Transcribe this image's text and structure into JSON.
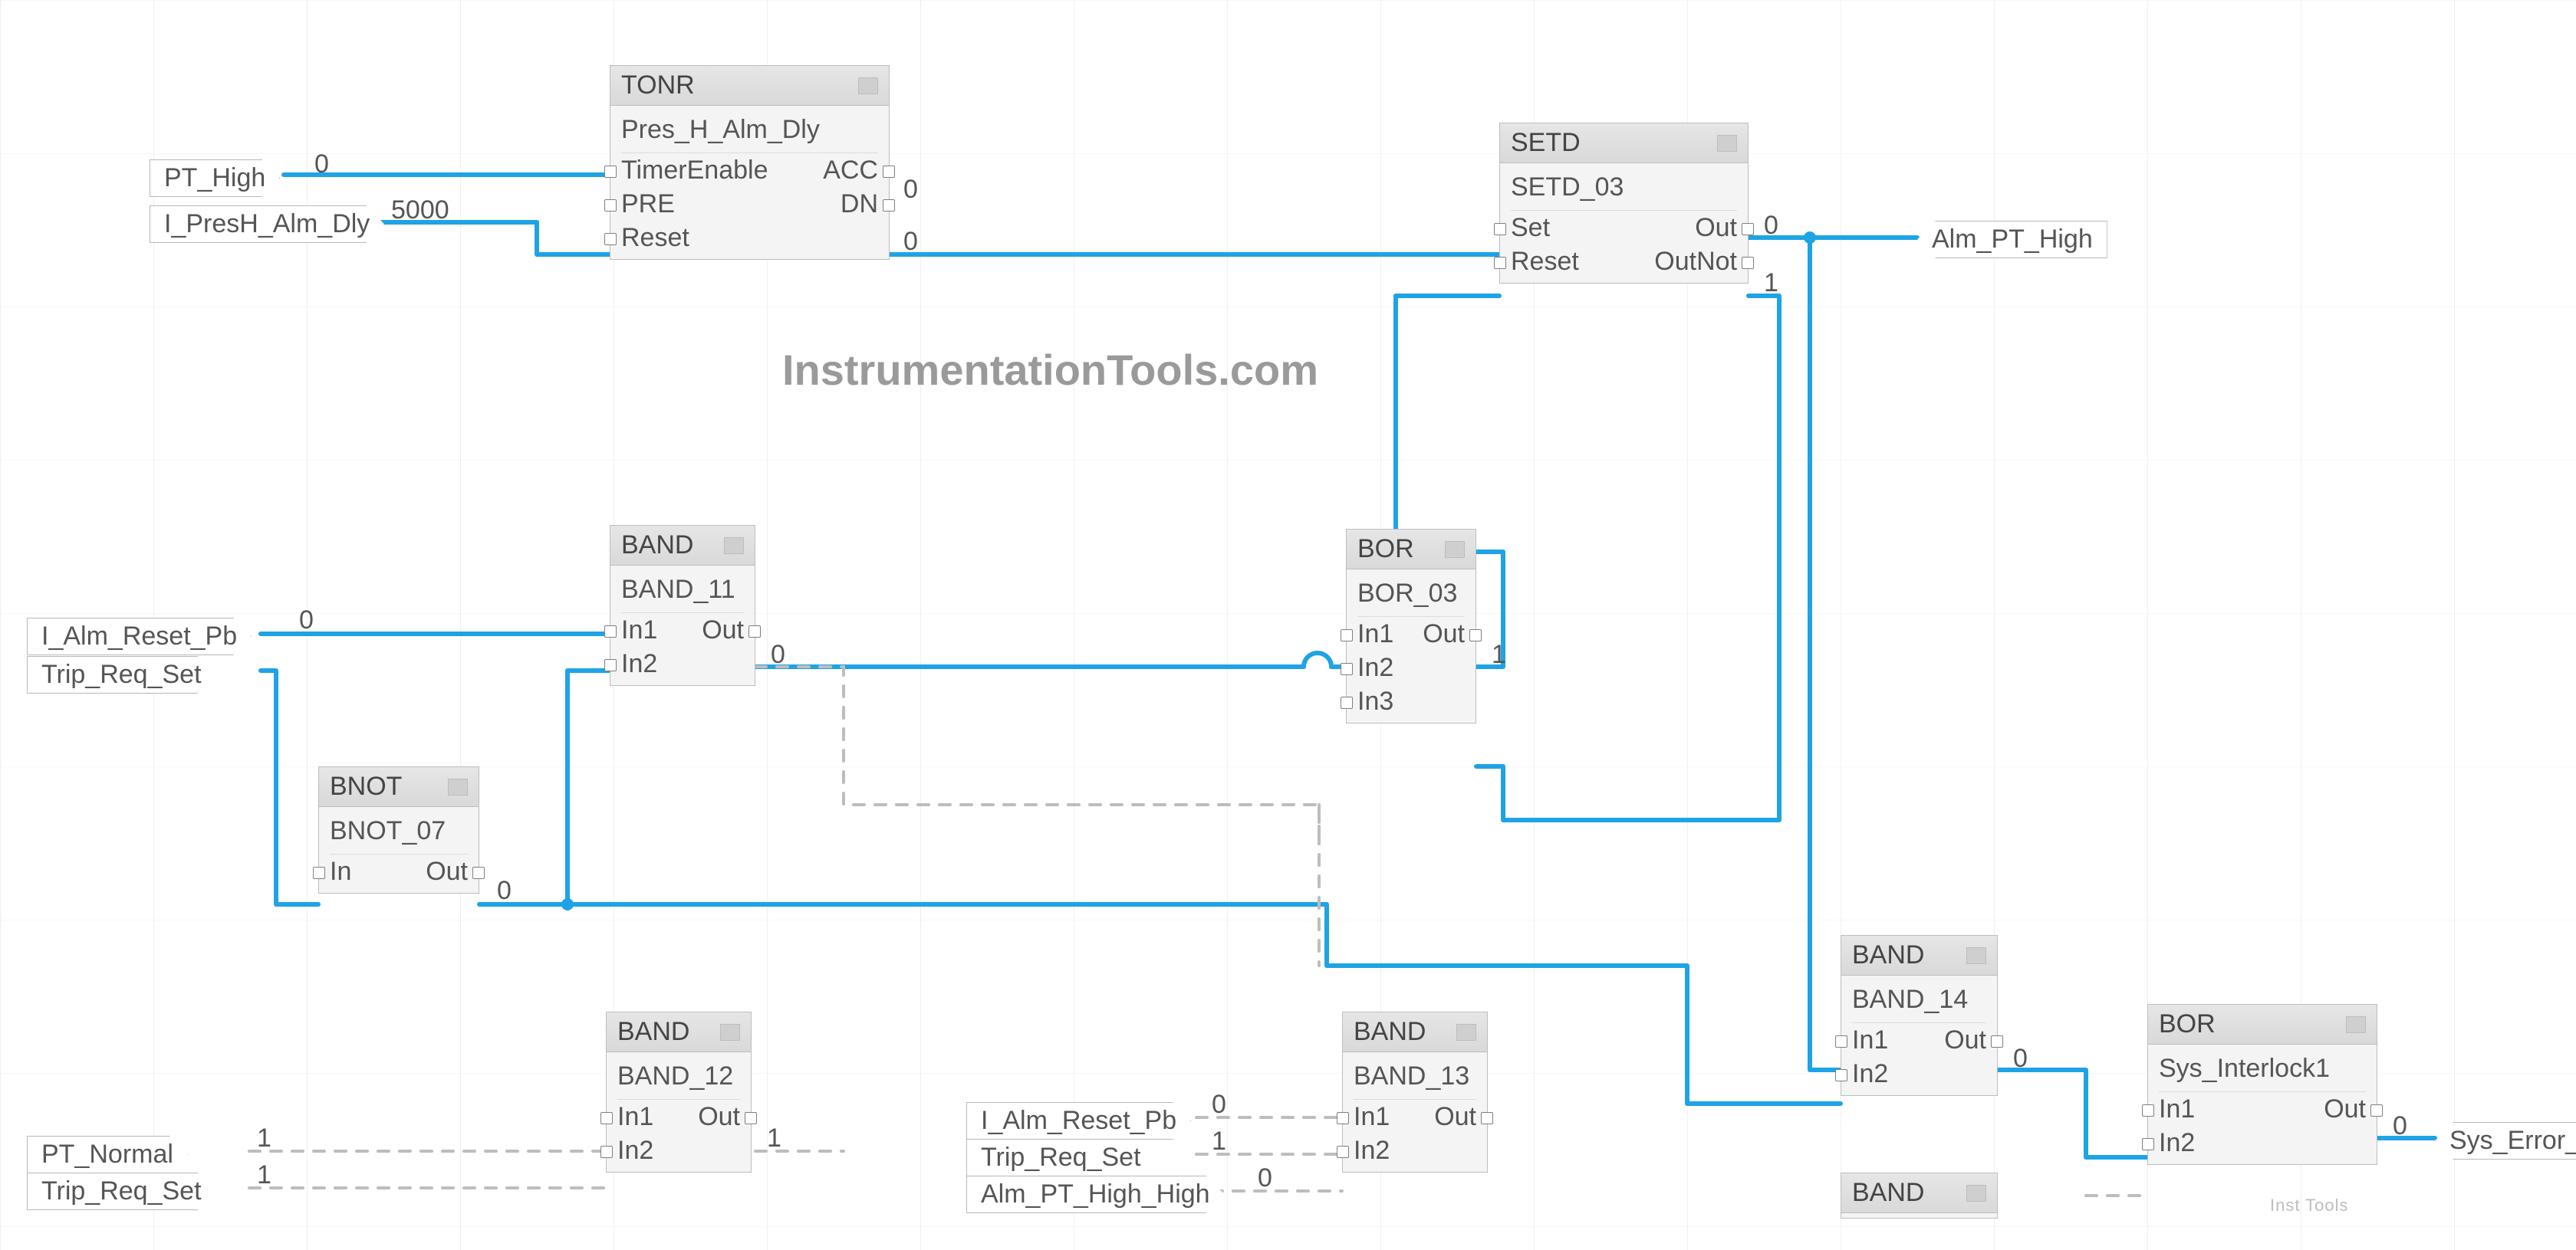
{
  "watermark": "InstrumentationTools.com",
  "watermark_small": "Inst Tools",
  "tags_in": {
    "pt_high": "PT_High",
    "i_presh_alm_dly": "I_PresH_Alm_Dly",
    "i_alm_reset_pb_1": "I_Alm_Reset_Pb",
    "trip_req_set_1": "Trip_Req_Set",
    "pt_normal": "PT_Normal",
    "trip_req_set_2": "Trip_Req_Set",
    "i_alm_reset_pb_2": "I_Alm_Reset_Pb",
    "trip_req_set_3": "Trip_Req_Set",
    "alm_pt_high_high": "Alm_PT_High_High"
  },
  "tags_out": {
    "alm_pt_high": "Alm_PT_High",
    "sys_error_pt": "Sys_Error_PT"
  },
  "values": {
    "pt_high": "0",
    "i_presh_alm_dly": "5000",
    "tonr_acc": "0",
    "tonr_dn": "0",
    "setd_out": "0",
    "setd_outnot": "1",
    "i_alm_reset_pb_1": "0",
    "band11_out": "0",
    "bnot07_out": "0",
    "bor03_out": "1",
    "band12_out": "1",
    "pt_normal": "1",
    "trip_req_set_2": "1",
    "i_alm_reset_pb_2": "0",
    "trip_req_set_3": "1",
    "alm_pt_high_high": "0",
    "band14_out": "0",
    "sys_interlock1_out": "0"
  },
  "blocks": {
    "tonr": {
      "type": "TONR",
      "instance": "Pres_H_Alm_Dly",
      "ports": {
        "timer_enable": "TimerEnable",
        "pre": "PRE",
        "reset": "Reset",
        "acc": "ACC",
        "dn": "DN"
      }
    },
    "setd": {
      "type": "SETD",
      "instance": "SETD_03",
      "ports": {
        "set": "Set",
        "reset": "Reset",
        "out": "Out",
        "outnot": "OutNot"
      }
    },
    "band11": {
      "type": "BAND",
      "instance": "BAND_11",
      "ports": {
        "in1": "In1",
        "in2": "In2",
        "out": "Out"
      }
    },
    "bnot07": {
      "type": "BNOT",
      "instance": "BNOT_07",
      "ports": {
        "in": "In",
        "out": "Out"
      }
    },
    "bor03": {
      "type": "BOR",
      "instance": "BOR_03",
      "ports": {
        "in1": "In1",
        "in2": "In2",
        "in3": "In3",
        "out": "Out"
      }
    },
    "band12": {
      "type": "BAND",
      "instance": "BAND_12",
      "ports": {
        "in1": "In1",
        "in2": "In2",
        "out": "Out"
      }
    },
    "band13": {
      "type": "BAND",
      "instance": "BAND_13",
      "ports": {
        "in1": "In1",
        "in2": "In2",
        "out": "Out"
      }
    },
    "band14": {
      "type": "BAND",
      "instance": "BAND_14",
      "ports": {
        "in1": "In1",
        "in2": "In2",
        "out": "Out"
      }
    },
    "sys_interlock1": {
      "type": "BOR",
      "instance": "Sys_Interlock1",
      "ports": {
        "in1": "In1",
        "in2": "In2",
        "out": "Out"
      }
    },
    "band_partial": {
      "type": "BAND"
    }
  }
}
